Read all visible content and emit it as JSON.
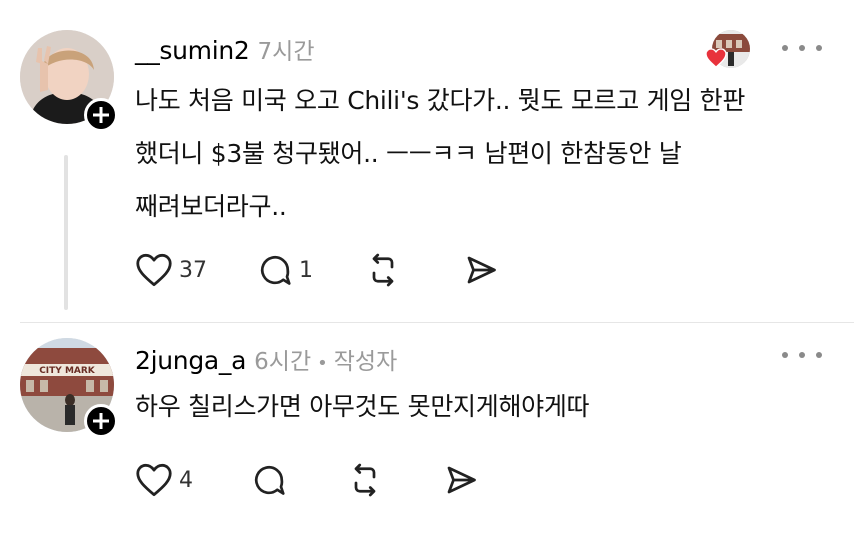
{
  "comments": [
    {
      "username": "__sumin2",
      "time": "7시간",
      "text_lines": [
        "나도 처음 미국 오고 Chili's 갔다가.. 뭣도 모르고 게임 한판",
        "했더니 $3불 청구됐어.. ㅡㅡㅋㅋ 남편이 한참동안 날",
        "째려보더라구.."
      ],
      "likes": "37",
      "replies": "1"
    },
    {
      "username": "2junga_a",
      "time": "6시간",
      "separator": "•",
      "author_tag": "작성자",
      "text_lines": [
        "하우 칠리스가면 아무것도 못만지게해야게따"
      ],
      "likes": "4",
      "avatar_sign_text": "CITY MARK"
    }
  ],
  "colors": {
    "heart_badge": "#e8323c",
    "muted_text": "#9a9a9a",
    "thread_line": "#e2e2e2"
  },
  "icons": [
    "heart-icon",
    "comment-icon",
    "repost-icon",
    "share-icon",
    "more-icon",
    "plus-icon"
  ]
}
